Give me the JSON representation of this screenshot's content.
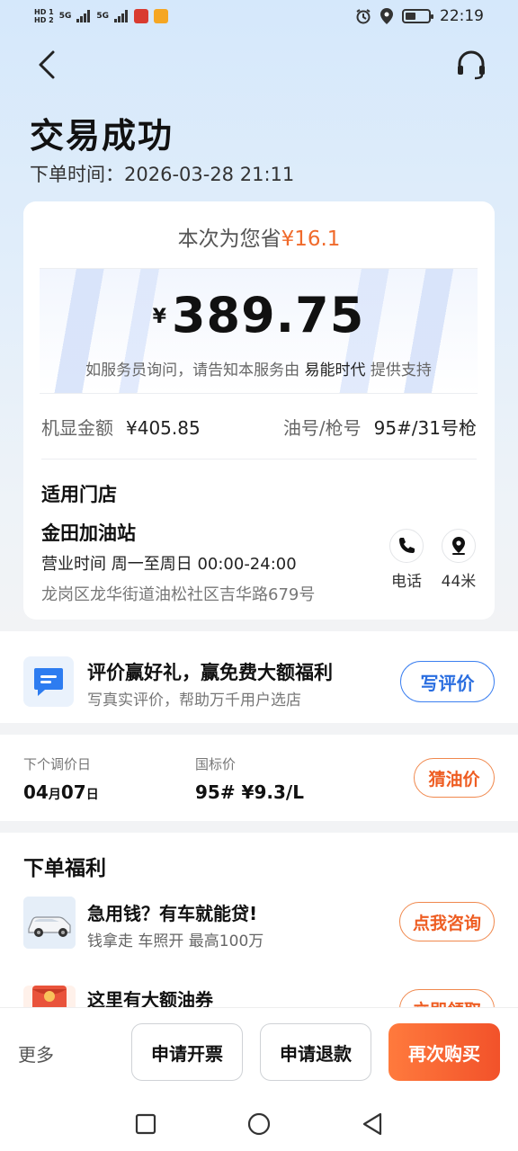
{
  "status_bar": {
    "hd1": "HD 1",
    "hd2": "HD 2",
    "signal1": "5G",
    "signal2": "5G",
    "time": "22:19",
    "battery_level": 0.45,
    "colors": {
      "app1": "#d93b30",
      "app2": "#f5a623"
    },
    "icons": [
      "alarm-icon",
      "location-icon",
      "battery-icon"
    ]
  },
  "nav": {
    "back_icon": "chevron-left-icon",
    "support_icon": "headset-icon"
  },
  "header": {
    "title": "交易成功",
    "order_time": "下单时间：2026-03-28 21:11"
  },
  "summary": {
    "saving_prefix": "本次为您省",
    "saving_amount": "¥16.1",
    "currency": "¥",
    "amount": "389.75",
    "notice_prefix": "如服务员询问，请告知本服务由",
    "notice_brand": "易能时代",
    "notice_suffix": "提供支持",
    "display_amount_label": "机显金额",
    "display_amount_value": "¥405.85",
    "pump_label": "油号/枪号",
    "pump_value": "95#/31号枪"
  },
  "store": {
    "section_title": "适用门店",
    "name": "金田加油站",
    "hours": "营业时间 周一至周日 00:00-24:00",
    "address": "龙岗区龙华街道油松社区吉华路679号",
    "call_label": "电话",
    "distance_label": "44米"
  },
  "review": {
    "title": "评价赢好礼，赢免费大额福利",
    "subtitle": "写真实评价，帮助万千用户选店",
    "button": "写评价"
  },
  "price": {
    "next_adjust_label": "下个调价日",
    "next_adjust_month": "04",
    "month_unit": "月",
    "next_adjust_day": "07",
    "day_unit": "日",
    "national_label": "国标价",
    "national_value": "95# ¥9.3/L",
    "button": "猜油价"
  },
  "benefits": {
    "title": "下单福利",
    "items": [
      {
        "title": "急用钱？有车就能贷!",
        "subtitle": "钱拿走 车照开 最高100万",
        "button": "点我咨询"
      },
      {
        "title": "这里有大额油券",
        "subtitle": "",
        "button": "立即领取"
      }
    ]
  },
  "bottom_bar": {
    "more": "更多",
    "invoice": "申请开票",
    "refund": "申请退款",
    "rebuy": "再次购买"
  },
  "colors": {
    "accent_orange": "#f06a2b",
    "accent_blue": "#2a6ee0"
  }
}
